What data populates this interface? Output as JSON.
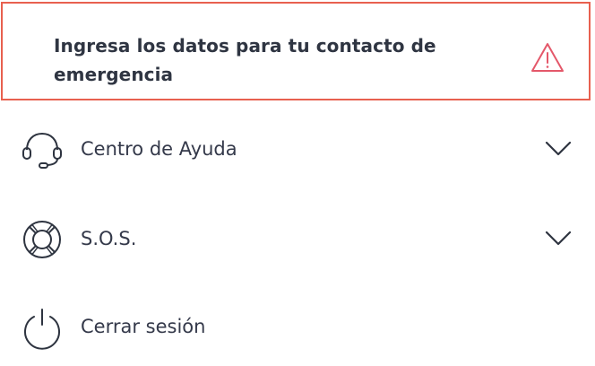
{
  "alert": {
    "message": "Ingresa los datos para tu contacto de emergencia",
    "icon": "warning-icon",
    "border_color": "#e8604f",
    "icon_color": "#e4586a"
  },
  "menu": {
    "items": [
      {
        "label": "Centro de Ayuda",
        "icon": "headset-icon",
        "expandable": true
      },
      {
        "label": "S.O.S.",
        "icon": "lifebuoy-icon",
        "expandable": true
      },
      {
        "label": "Cerrar sesión",
        "icon": "power-icon",
        "expandable": false
      }
    ]
  },
  "colors": {
    "text": "#34394a",
    "icon_stroke": "#2e3440"
  }
}
